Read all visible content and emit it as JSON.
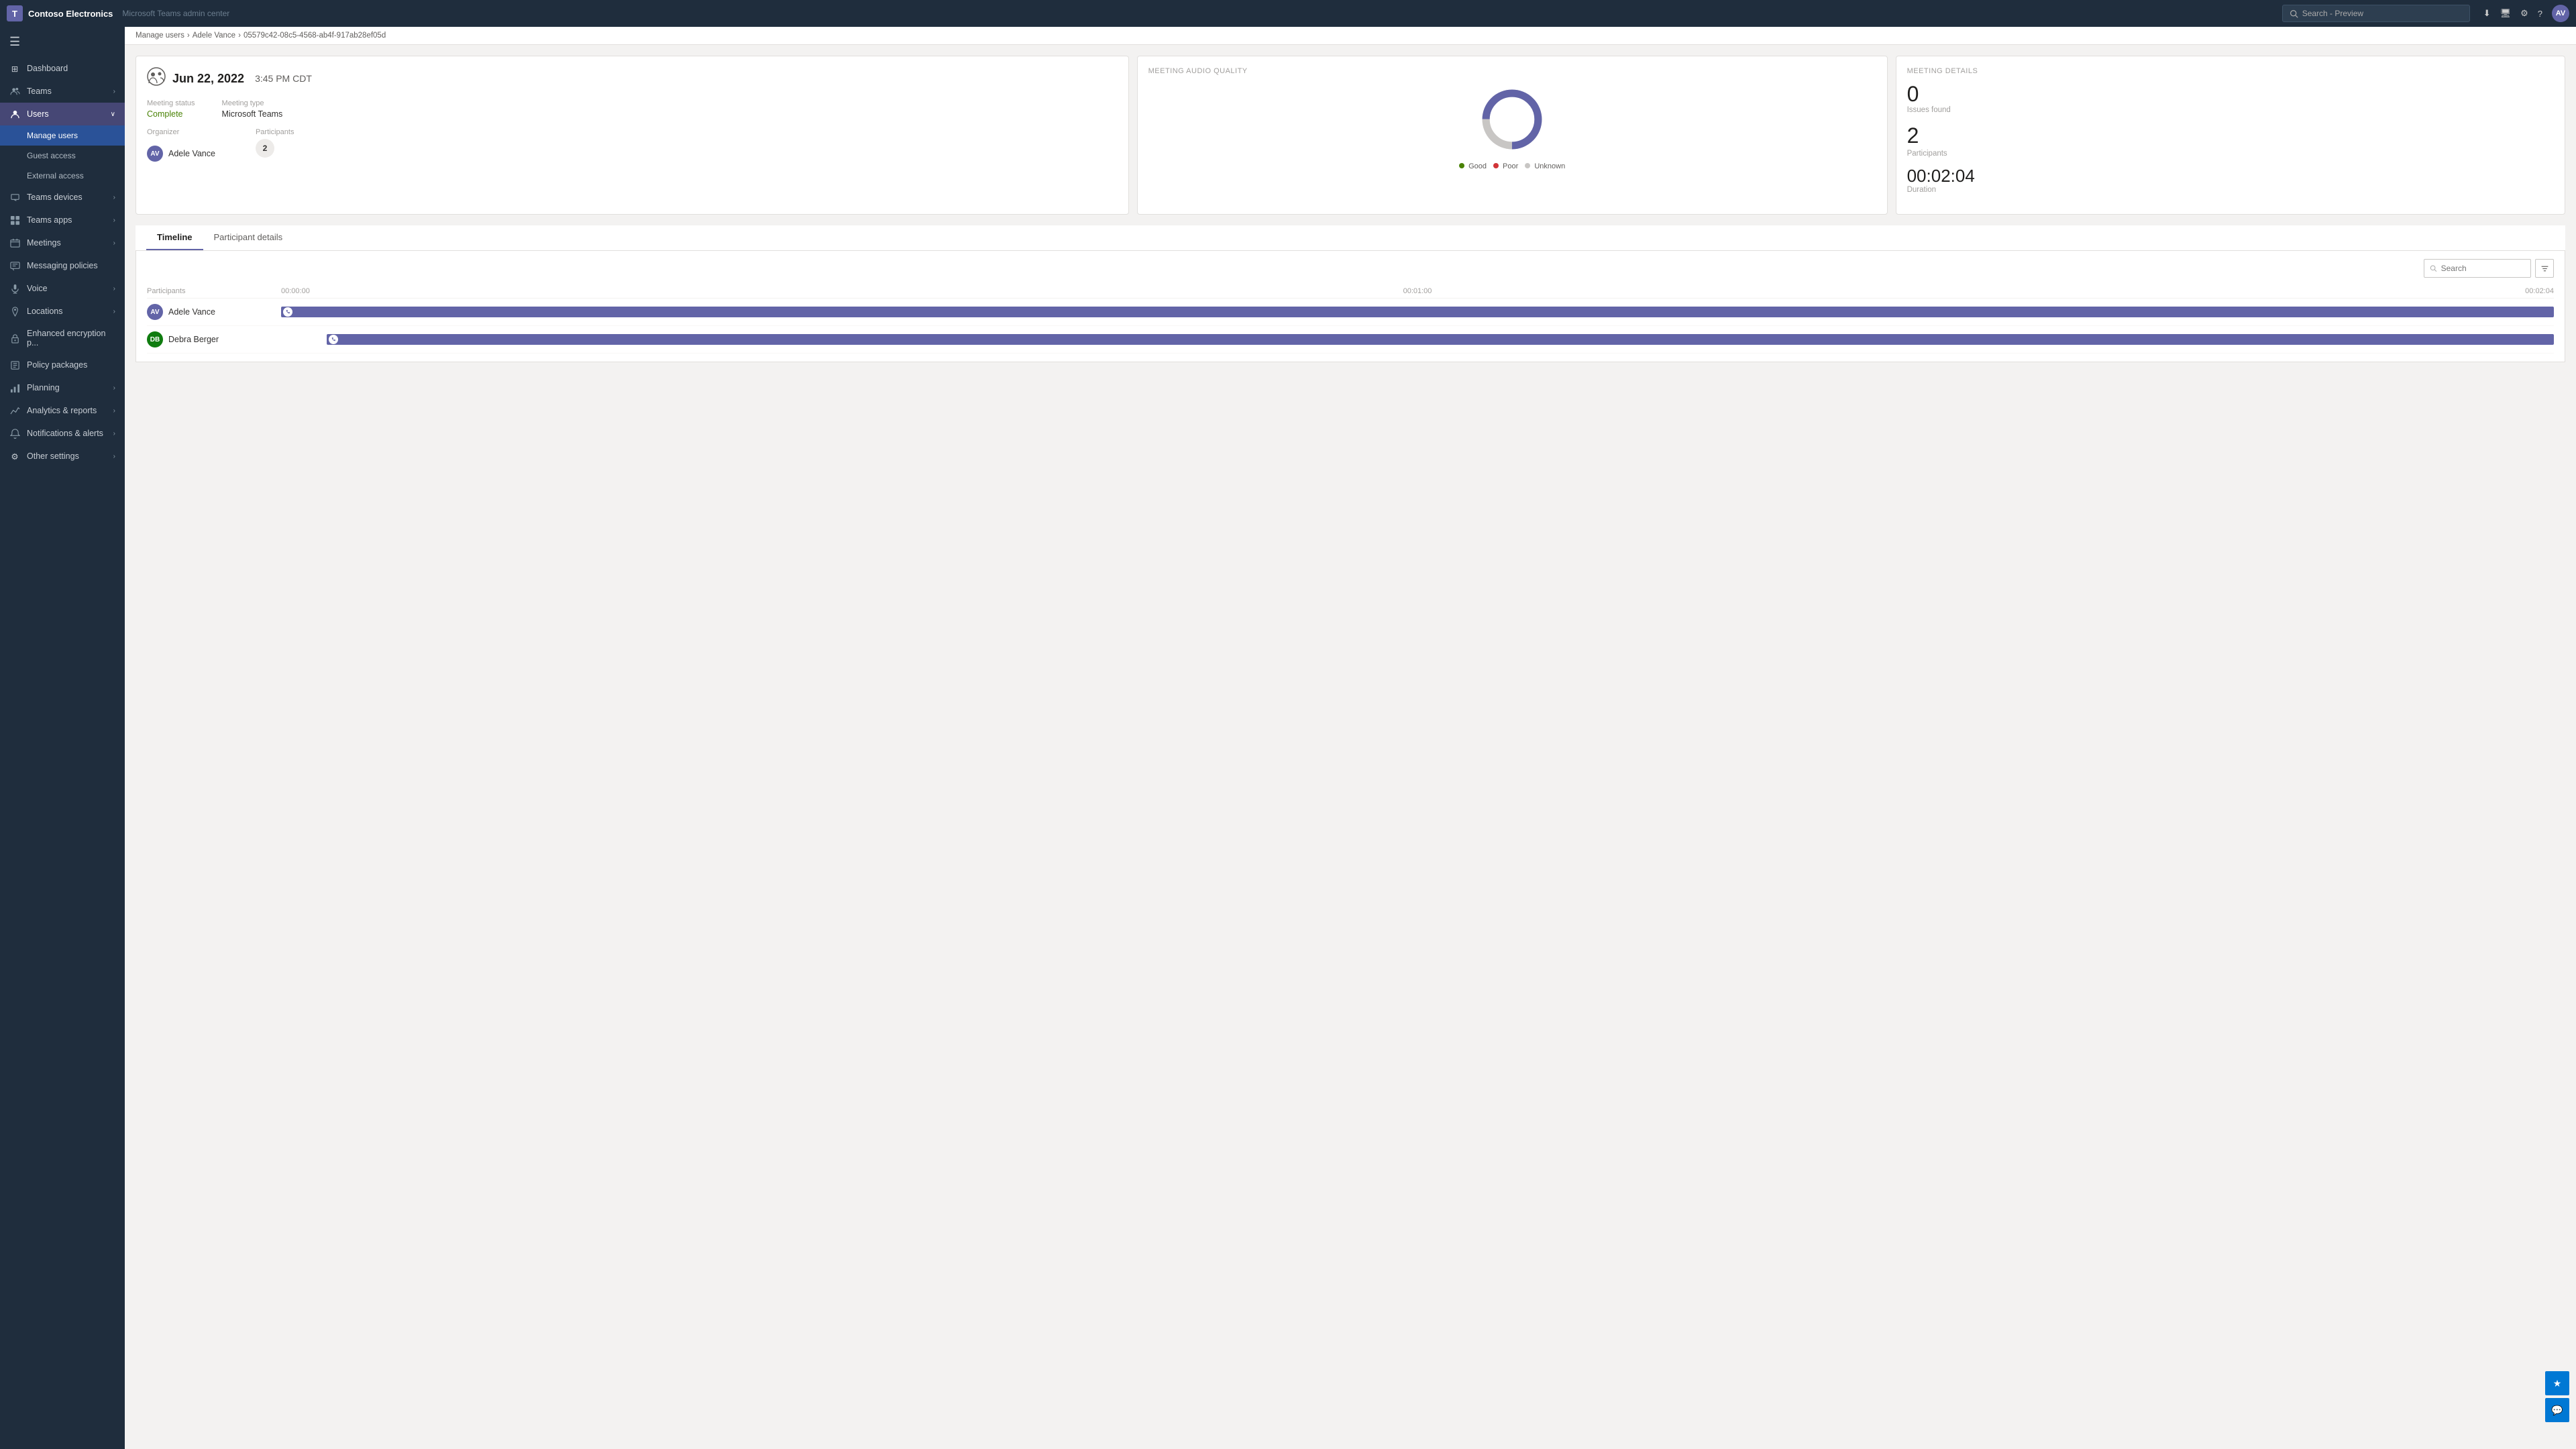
{
  "app": {
    "logo_text": "Contoso Electronics",
    "admin_title": "Microsoft Teams admin center",
    "search_placeholder": "Search - Preview",
    "avatar_initials": "AV"
  },
  "breadcrumb": {
    "items": [
      "Manage users",
      "Adele Vance",
      "05579c42-08c5-4568-ab4f-917ab28ef05d"
    ]
  },
  "meeting_card": {
    "date": "Jun 22, 2022",
    "time": "3:45 PM CDT",
    "meeting_status_label": "Meeting status",
    "meeting_status_value": "Complete",
    "meeting_type_label": "Meeting type",
    "meeting_type_value": "Microsoft Teams",
    "organizer_label": "Organizer",
    "organizer_name": "Adele Vance",
    "organizer_initials": "AV",
    "participants_label": "Participants",
    "participants_count": "2"
  },
  "audio_quality_card": {
    "title": "MEETING AUDIO QUALITY",
    "legend": [
      {
        "label": "Good",
        "color": "#498205"
      },
      {
        "label": "Poor",
        "color": "#d13438"
      },
      {
        "label": "Unknown",
        "color": "#c8c6c4"
      }
    ],
    "donut": {
      "good_pct": 75,
      "poor_pct": 0,
      "unknown_pct": 25
    }
  },
  "meeting_details_card": {
    "title": "MEETING DETAILS",
    "issues_label": "Issues found",
    "issues_value": "0",
    "participants_label": "Participants",
    "participants_value": "2",
    "duration_label": "Duration",
    "duration_value": "00:02:04"
  },
  "tabs": [
    {
      "id": "timeline",
      "label": "Timeline",
      "active": true
    },
    {
      "id": "participant-details",
      "label": "Participant details",
      "active": false
    }
  ],
  "timeline": {
    "search_placeholder": "Search",
    "columns": {
      "participants": "Participants",
      "start": "00:00:00",
      "mid": "00:01:00",
      "end": "00:02:04"
    },
    "participants": [
      {
        "name": "Adele Vance",
        "initials": "AV",
        "bar_left": "0%",
        "bar_width": "100%"
      },
      {
        "name": "Debra Berger",
        "initials": "DB",
        "bar_left": "2%",
        "bar_width": "98%"
      }
    ]
  },
  "sidebar": {
    "hamburger_label": "☰",
    "items": [
      {
        "id": "dashboard",
        "label": "Dashboard",
        "icon": "⊞",
        "has_children": false,
        "active": false
      },
      {
        "id": "teams",
        "label": "Teams",
        "icon": "👥",
        "has_children": true,
        "active": false
      },
      {
        "id": "users",
        "label": "Users",
        "icon": "👤",
        "has_children": true,
        "active": true,
        "children": [
          {
            "id": "manage-users",
            "label": "Manage users",
            "active": true
          },
          {
            "id": "guest-access",
            "label": "Guest access",
            "active": false
          },
          {
            "id": "external-access",
            "label": "External access",
            "active": false
          }
        ]
      },
      {
        "id": "teams-devices",
        "label": "Teams devices",
        "icon": "📱",
        "has_children": true,
        "active": false
      },
      {
        "id": "teams-apps",
        "label": "Teams apps",
        "icon": "🧩",
        "has_children": true,
        "active": false
      },
      {
        "id": "meetings",
        "label": "Meetings",
        "icon": "📅",
        "has_children": true,
        "active": false
      },
      {
        "id": "messaging-policies",
        "label": "Messaging policies",
        "icon": "💬",
        "has_children": false,
        "active": false
      },
      {
        "id": "voice",
        "label": "Voice",
        "icon": "🎙️",
        "has_children": true,
        "active": false
      },
      {
        "id": "locations",
        "label": "Locations",
        "icon": "📍",
        "has_children": true,
        "active": false
      },
      {
        "id": "enhanced-encryption",
        "label": "Enhanced encryption p...",
        "icon": "🔒",
        "has_children": false,
        "active": false
      },
      {
        "id": "policy-packages",
        "label": "Policy packages",
        "icon": "📦",
        "has_children": false,
        "active": false
      },
      {
        "id": "planning",
        "label": "Planning",
        "icon": "📊",
        "has_children": true,
        "active": false
      },
      {
        "id": "analytics-reports",
        "label": "Analytics & reports",
        "icon": "📈",
        "has_children": true,
        "active": false
      },
      {
        "id": "notifications-alerts",
        "label": "Notifications & alerts",
        "icon": "🔔",
        "has_children": true,
        "active": false
      },
      {
        "id": "other-settings",
        "label": "Other settings",
        "icon": "⚙️",
        "has_children": true,
        "active": false
      }
    ]
  },
  "floating": {
    "btn1_icon": "★",
    "btn2_icon": "💬"
  }
}
